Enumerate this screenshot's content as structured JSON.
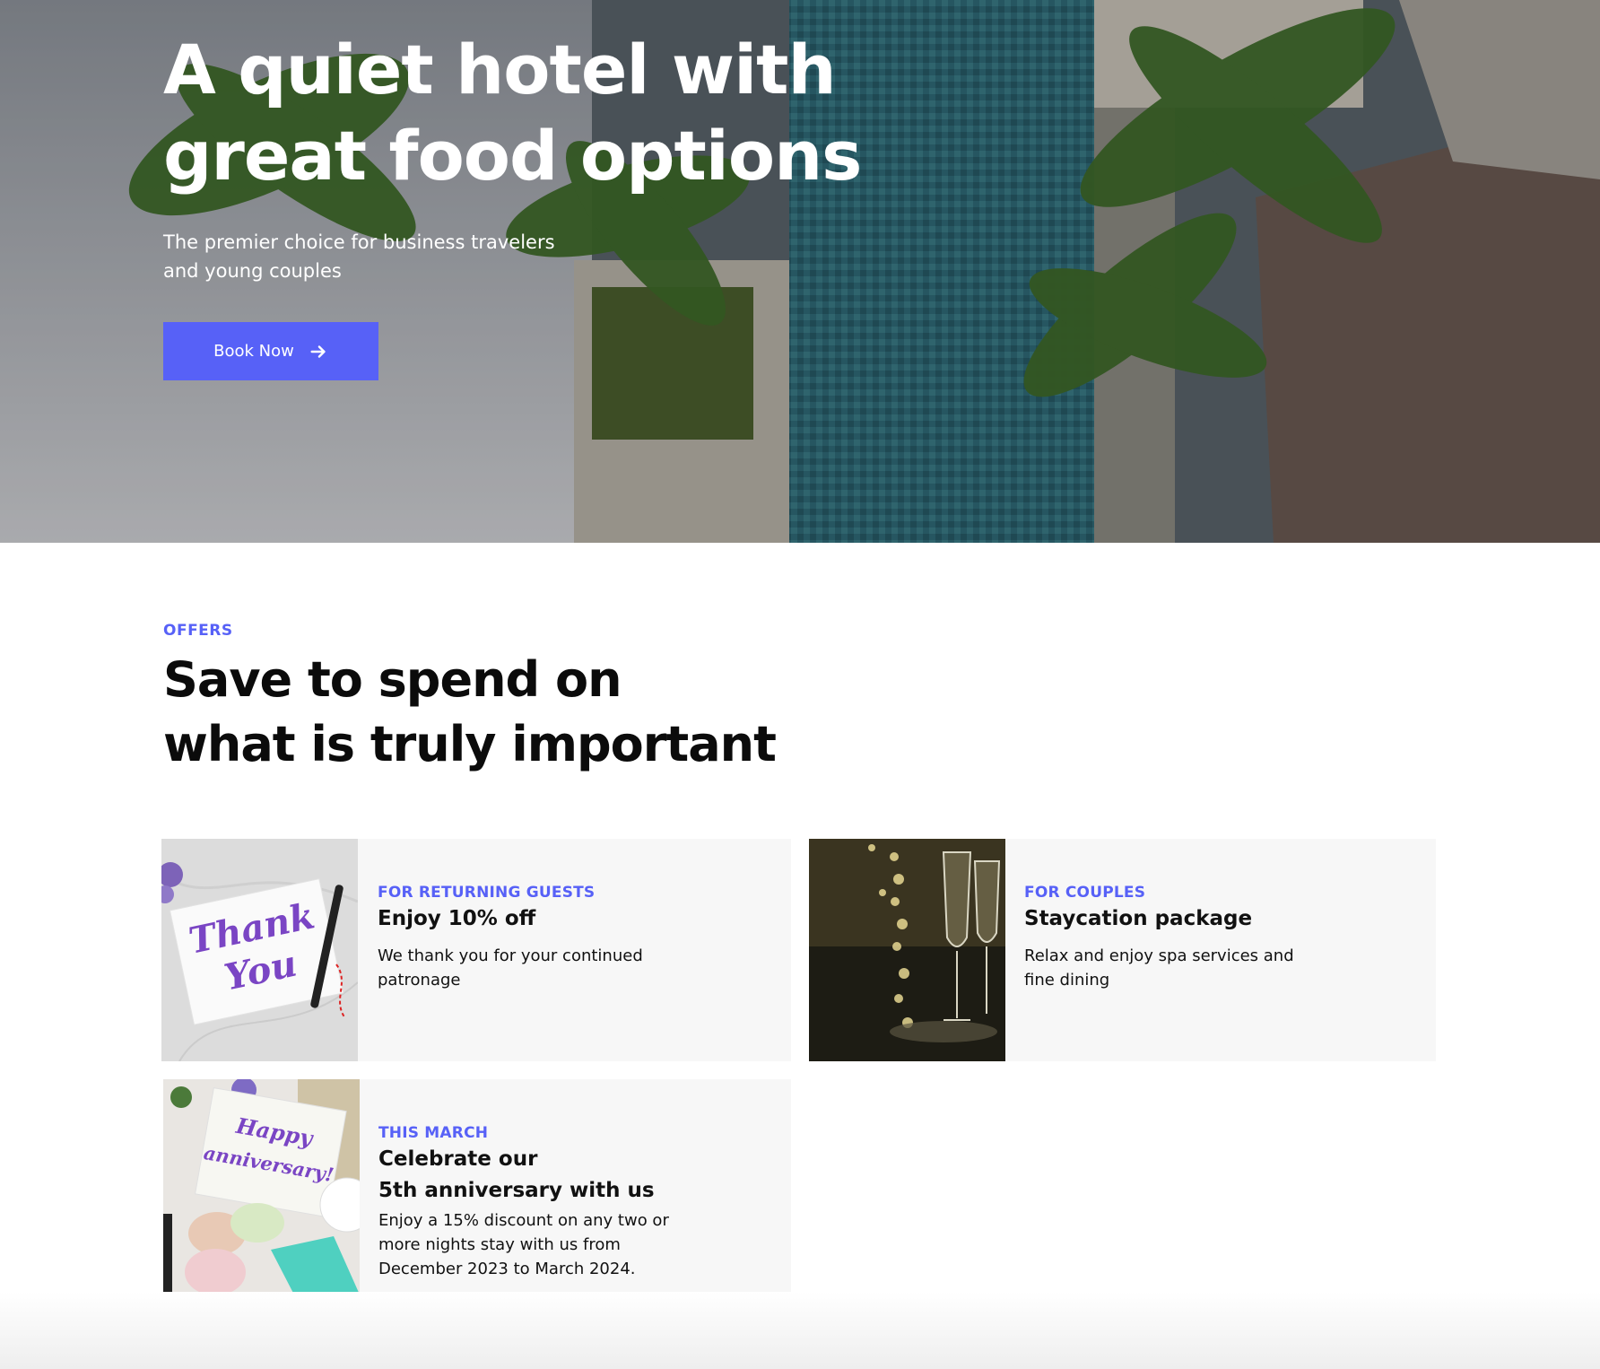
{
  "hero": {
    "title_line1": "A quiet hotel with",
    "title_line2": "great food options",
    "subtitle_line1": "The premier choice for business travelers",
    "subtitle_line2": "and young couples",
    "cta_label": "Book Now",
    "cta_icon": "arrow-right-icon"
  },
  "offers": {
    "eyebrow": "OFFERS",
    "title_line1": "Save to spend on",
    "title_line2": "what is truly important",
    "cards": [
      {
        "tag": "FOR RETURNING GUESTS",
        "title_line1": "Enjoy 10% off",
        "text_line1": "We thank you for your continued",
        "text_line2": "patronage",
        "image_caption_line1": "Thank",
        "image_caption_line2": "You"
      },
      {
        "tag": "FOR COUPLES",
        "title_line1": "Staycation package",
        "text_line1": "Relax and enjoy spa services and",
        "text_line2": "fine dining"
      },
      {
        "tag": "THIS MARCH",
        "title_line1": "Celebrate our",
        "title_line2": "5th anniversary with us",
        "text_line1": "Enjoy a 15% discount on any two or",
        "text_line2": "more nights stay with us from",
        "text_line3": "December 2023 to March 2024.",
        "image_caption_line1": "Happy",
        "image_caption_line2": "anniversary!"
      }
    ]
  },
  "colors": {
    "accent": "#5761f7",
    "card_bg": "#f7f7f7",
    "heading": "#0b0b0b"
  }
}
